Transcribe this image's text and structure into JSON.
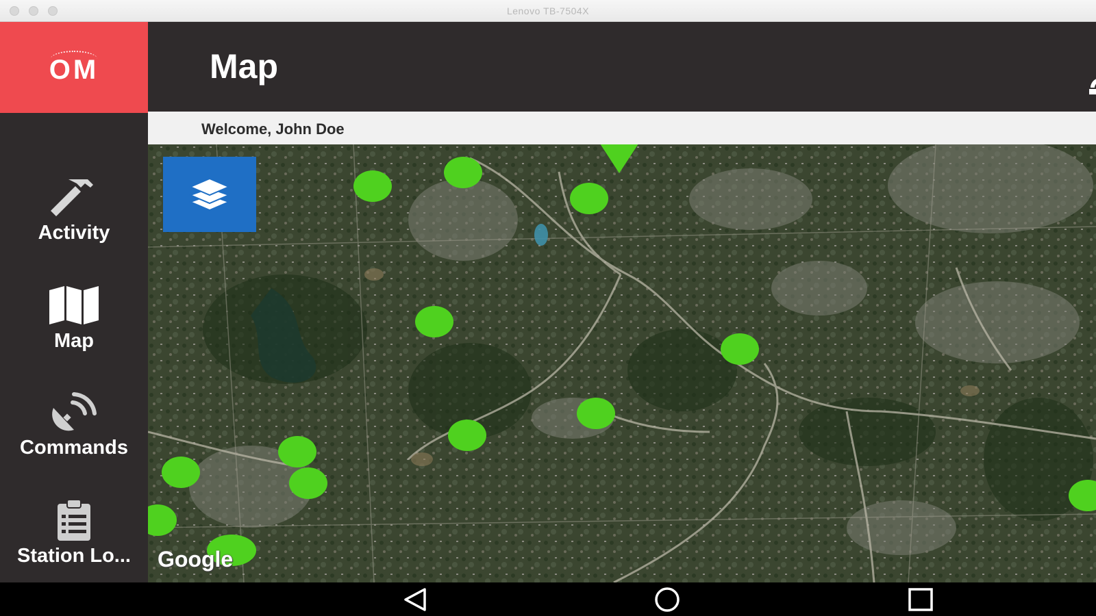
{
  "window": {
    "title": "Lenovo TB-7504X"
  },
  "app": {
    "logo_text": "OM"
  },
  "sidebar": {
    "items": [
      {
        "label": "Activity",
        "icon": "hammer-icon"
      },
      {
        "label": "Map",
        "icon": "map-icon"
      },
      {
        "label": "Commands",
        "icon": "satellite-dish-icon"
      },
      {
        "label": "Station Lo...",
        "icon": "clipboard-icon"
      }
    ]
  },
  "header": {
    "title": "Map"
  },
  "welcome": {
    "text": "Welcome, John Doe"
  },
  "map": {
    "attribution": "Google",
    "layers_button_icon": "layers-icon",
    "marker_color": "#4fd11f",
    "basemap": "satellite"
  },
  "android_nav": {
    "back_icon": "back-triangle-icon",
    "home_icon": "home-circle-icon",
    "recents_icon": "recents-square-icon"
  },
  "colors": {
    "brand_red": "#ef4a4f",
    "sidebar_bg": "#2f2b2c",
    "layers_button": "#1f6fc5"
  }
}
